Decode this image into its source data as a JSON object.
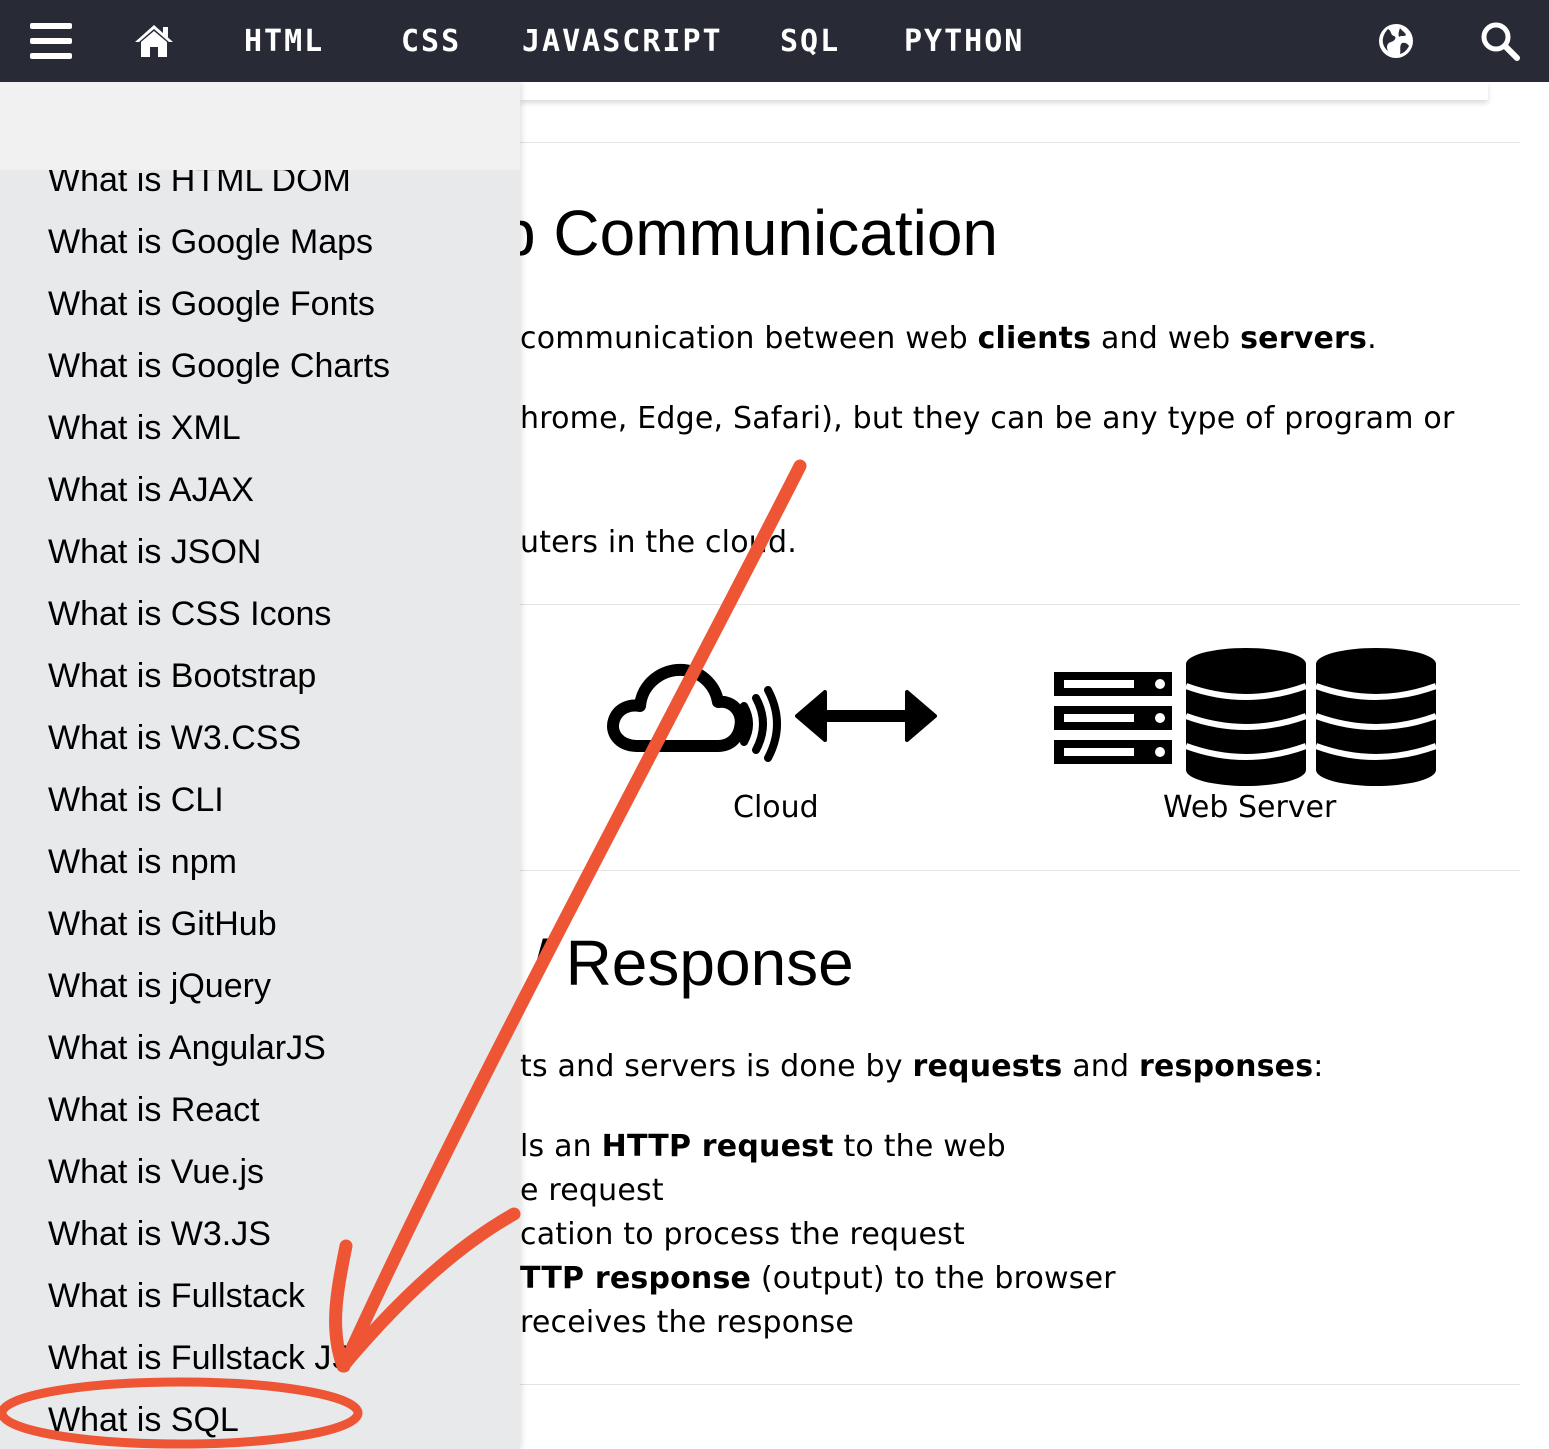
{
  "colors": {
    "topbar_bg": "#282a35",
    "sidebar_bg": "#e7e9eb",
    "annotation": "#ee5535"
  },
  "topbar": {
    "menu_icon": "hamburger-menu-icon",
    "home_icon": "home-icon",
    "links": [
      "HTML",
      "CSS",
      "JAVASCRIPT",
      "SQL",
      "PYTHON"
    ],
    "globe_icon": "globe-icon",
    "search_icon": "search-icon"
  },
  "sidebar": {
    "items": [
      "What is HTML DOM",
      "What is Google Maps",
      "What is Google Fonts",
      "What is Google Charts",
      "What is XML",
      "What is AJAX",
      "What is JSON",
      "What is CSS Icons",
      "What is Bootstrap",
      "What is W3.CSS",
      "What is CLI",
      "What is npm",
      "What is GitHub",
      "What is jQuery",
      "What is AngularJS",
      "What is React",
      "What is Vue.js",
      "What is W3.JS",
      "What is Fullstack",
      "What is Fullstack JS",
      "What is SQL"
    ]
  },
  "main": {
    "section1": {
      "heading": "p Communication",
      "p1_a": "communication between web ",
      "p1_b": "clients",
      "p1_c": " and web ",
      "p1_d": "servers",
      "p1_e": ".",
      "p2": "hrome, Edge, Safari), but they can be any type of program or",
      "p3": "uters in the cloud."
    },
    "diagram": {
      "cloud_label": "Cloud",
      "server_label": "Web Server",
      "cloud_icon": "cloud-signal-icon",
      "arrow_icon": "double-arrow-icon",
      "server_icon": "server-rack-icon",
      "database_icon": "database-icon"
    },
    "section2": {
      "heading": "/ Response",
      "p1_a": "ts and servers is done by ",
      "p1_b": "requests",
      "p1_c": " and ",
      "p1_d": "responses",
      "p1_e": ":",
      "l1_a": "ls an ",
      "l1_b": "HTTP request",
      "l1_c": " to the web",
      "l2": "e request",
      "l3": "cation to process the request",
      "l4_a": "TTP response",
      "l4_b": " (output) to the browser",
      "l5": "receives the response"
    }
  }
}
